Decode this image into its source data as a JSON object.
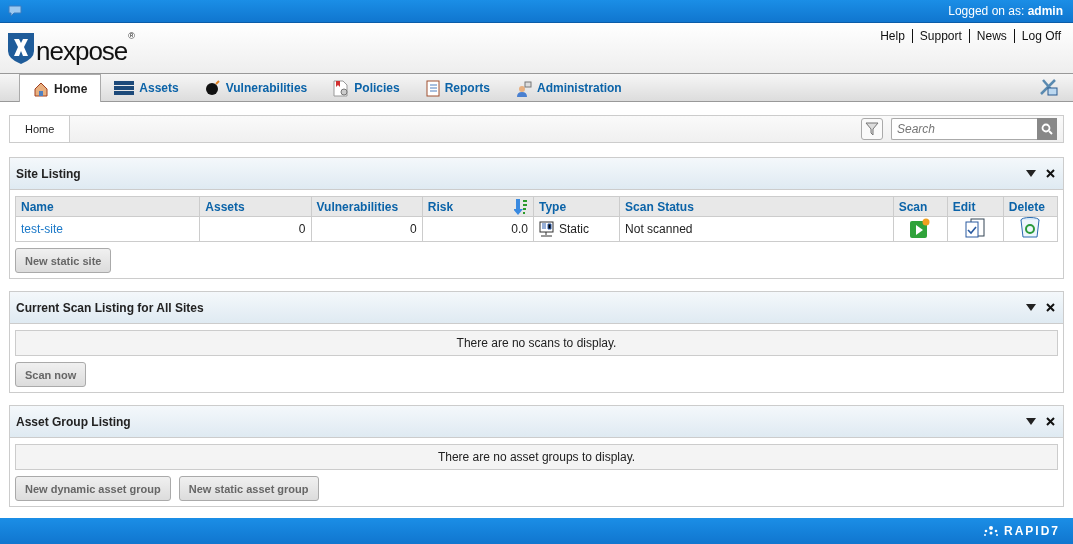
{
  "top_bar": {
    "user_label": "Logged on as:",
    "user": "admin"
  },
  "logo": {
    "name": "nexpose",
    "mark": "®"
  },
  "header_links": [
    "Help",
    "Support",
    "News",
    "Log Off"
  ],
  "tabs": [
    {
      "label": "Home",
      "selected": true
    },
    {
      "label": "Assets",
      "selected": false
    },
    {
      "label": "Vulnerabilities",
      "selected": false
    },
    {
      "label": "Policies",
      "selected": false
    },
    {
      "label": "Reports",
      "selected": false
    },
    {
      "label": "Administration",
      "selected": false
    }
  ],
  "breadcrumb": [
    "Home"
  ],
  "search": {
    "placeholder": "Search"
  },
  "panels": [
    {
      "title": "Site Listing",
      "kind": "table",
      "columns": [
        "Name",
        "Assets",
        "Vulnerabilities",
        "Risk",
        "Type",
        "Scan Status",
        "Scan",
        "Edit",
        "Delete"
      ],
      "rows": [
        {
          "name": "test-site",
          "assets": "0",
          "vulnerabilities": "0",
          "risk": "0.0",
          "type": "Static",
          "scan_status": "Not scanned"
        }
      ],
      "buttons": [
        "New static site"
      ]
    },
    {
      "title": "Current Scan Listing for All Sites",
      "kind": "empty",
      "message": "There are no scans to display.",
      "buttons": [
        "Scan now"
      ]
    },
    {
      "title": "Asset Group Listing",
      "kind": "empty",
      "message": "There are no asset groups to display.",
      "buttons": [
        "New dynamic asset group",
        "New static asset group"
      ]
    }
  ],
  "footer": {
    "brand": "RAPID7"
  }
}
